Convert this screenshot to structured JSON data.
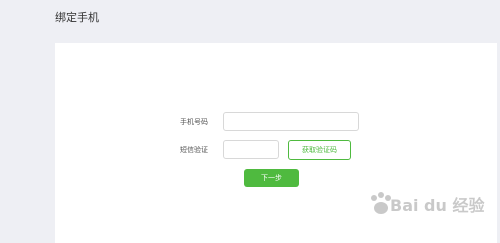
{
  "page": {
    "title": "绑定手机"
  },
  "form": {
    "phone_label": "手机号码",
    "phone_value": "",
    "code_label": "短信验证",
    "code_value": "",
    "get_code_label": "获取验证码",
    "next_label": "下一步"
  },
  "watermark": {
    "text": "Bai du 经验"
  },
  "colors": {
    "background": "#eeeff4",
    "panel": "#ffffff",
    "accent": "#4fba3f"
  }
}
